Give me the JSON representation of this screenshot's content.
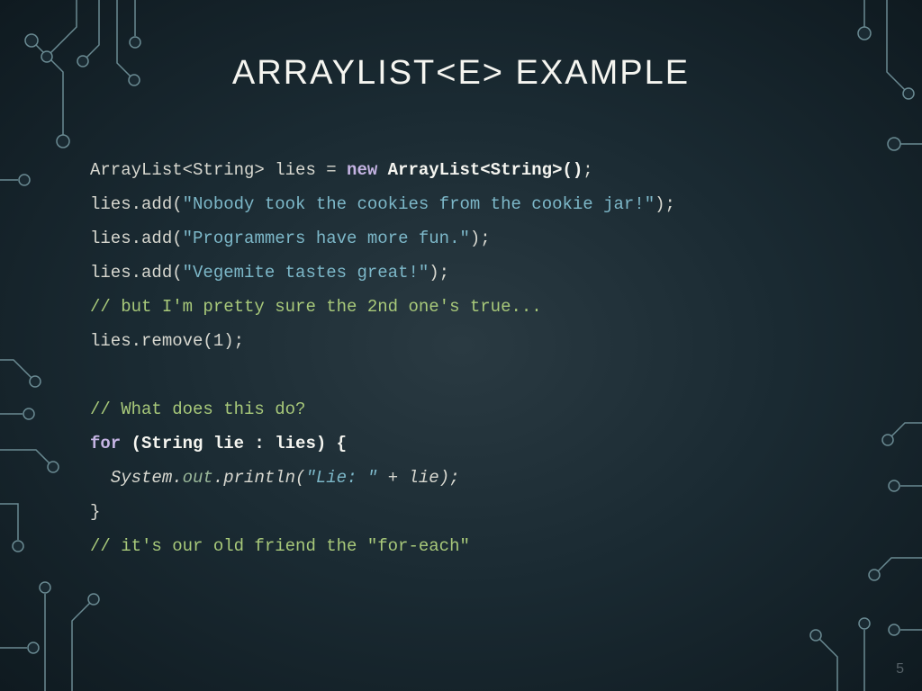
{
  "title": "ARRAYLIST<E> EXAMPLE",
  "pageNumber": "5",
  "code": {
    "l1": {
      "a": "ArrayList<String> lies = ",
      "b": "new ",
      "c": "ArrayList<String>()",
      "d": ";"
    },
    "l2": {
      "a": "lies.add(",
      "b": "\"Nobody took the cookies from the cookie jar!\"",
      "c": ");"
    },
    "l3": {
      "a": "lies.add(",
      "b": "\"Programmers have more fun.\"",
      "c": ");"
    },
    "l4": {
      "a": "lies.add(",
      "b": "\"Vegemite tastes great!\"",
      "c": ");"
    },
    "l5": "// but I'm pretty sure the 2nd one's true...",
    "l6": "lies.remove(1);",
    "l7": "",
    "l8": "// What does this do?",
    "l9": {
      "a": "for ",
      "b": "(String lie : lies) {"
    },
    "l10": {
      "a": "  System.",
      "b": "out",
      "c": ".println(",
      "d": "\"Lie: \" ",
      "e": "+ lie);"
    },
    "l11": "}",
    "l12": "// it's our old friend the \"for-each\""
  }
}
